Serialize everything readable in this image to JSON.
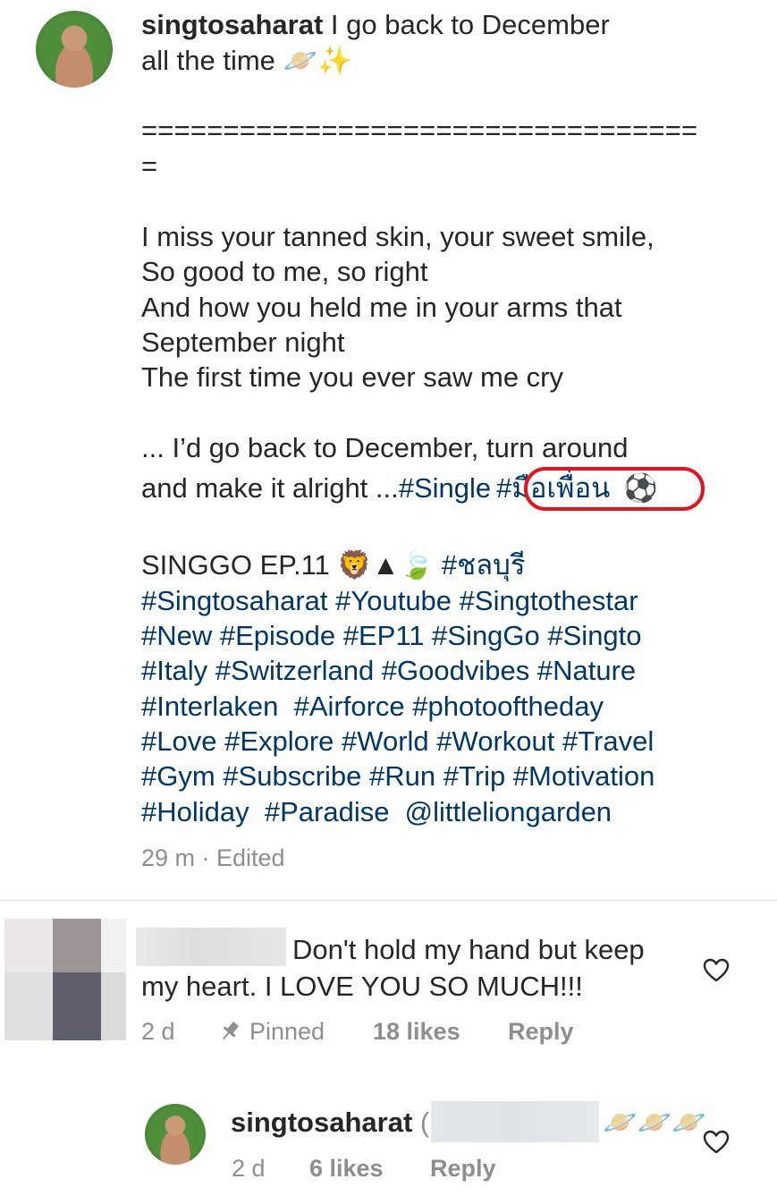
{
  "post": {
    "username": "singtosaharat",
    "caption_line1": " I go back to December",
    "caption_line2": "all the time 🪐✨",
    "separator_line1": "==================================",
    "separator_line2": "=",
    "lyrics": [
      "I miss your tanned skin, your sweet smile,",
      "So good to me, so right",
      "And how you held me in your arms that",
      "September night",
      "The first time you ever saw me cry"
    ],
    "closing_line1": "... I’d go back to December, turn around",
    "closing_line2_text": "and make it alright ...",
    "tag_single": "#Single",
    "tag_thai_friend": "#มือเพื่อน",
    "soccer_emoji": "⚽",
    "episode_text": "SINGGO EP.11 🦁▲🍃 ",
    "tag_chonburi": "#ชลบุรี",
    "hashtag_lines": [
      "#Singtosaharat #Youtube #Singtothestar",
      "#New #Episode #EP11 #SingGo #Singto",
      "#Italy #Switzerland #Goodvibes #Nature",
      "#Interlaken  #Airforce #photooftheday",
      "#Love #Explore #World #Workout #Travel",
      "#Gym #Subscribe #Run #Trip #Motivation",
      "#Holiday  #Paradise  @littleliongarden"
    ],
    "time": "29 m · Edited"
  },
  "comment1": {
    "text_line1": "Don't hold my hand but keep",
    "text_line2": "my heart. I LOVE YOU SO MUCH!!!",
    "time": "2 d",
    "pinned": "Pinned",
    "likes": "18 likes",
    "reply": "Reply"
  },
  "comment2": {
    "username": "singtosaharat",
    "paren": "(",
    "emojis": "🪐🪐🪐",
    "time": "2 d",
    "likes": "6 likes",
    "reply": "Reply"
  },
  "icons": {
    "heart": "heart-outline-icon",
    "pin": "pin-icon"
  },
  "colors": {
    "hashtag": "#00376b",
    "text": "#262626",
    "meta": "#8e8e8e",
    "highlight": "#e8121f"
  }
}
